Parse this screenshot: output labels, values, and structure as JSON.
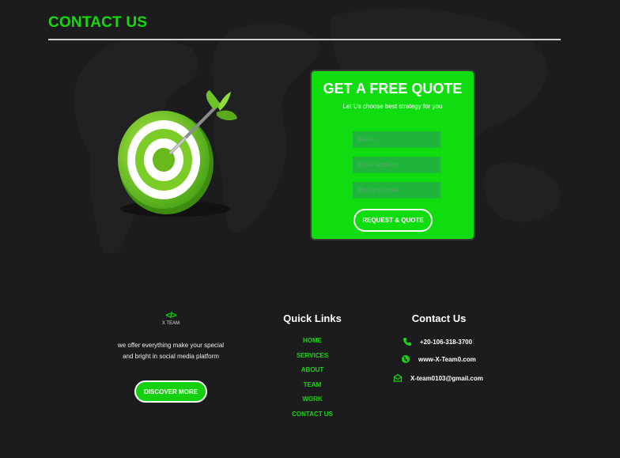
{
  "section": {
    "title": "CONTACT US"
  },
  "quote": {
    "title": "GET A FREE QUOTE",
    "subtitle": "Let Us choose best strategy for you",
    "name_placeholder": "Name",
    "email_placeholder": "Email address",
    "phone_placeholder": "Phone number",
    "button_label": "REQUEST & QUOTE"
  },
  "footer": {
    "logo_mark": "</>",
    "logo_text": "X TEAM",
    "about_line1": "we offer everything make your special",
    "about_line2": "and bright in social media platform",
    "discover_label": "DISCOVER MORE",
    "quick_links_title": "Quick Links",
    "links": [
      {
        "label": "HOME"
      },
      {
        "label": "SERVICES"
      },
      {
        "label": "ABOUT"
      },
      {
        "label": "TEAM"
      },
      {
        "label": "WORK"
      },
      {
        "label": "CONTACT US"
      }
    ],
    "contact_title": "Contact Us",
    "phone": "+20-106-318-3700",
    "website": "www-X-Team0.com",
    "email": "X-team0103@gmail.com"
  },
  "icons": {
    "target": "target-dart-icon",
    "phone": "phone-icon",
    "web": "globe-icon",
    "mail": "envelope-icon"
  },
  "colors": {
    "accent": "#16d80e",
    "card": "#10dd10",
    "background": "#1c1c1f"
  }
}
